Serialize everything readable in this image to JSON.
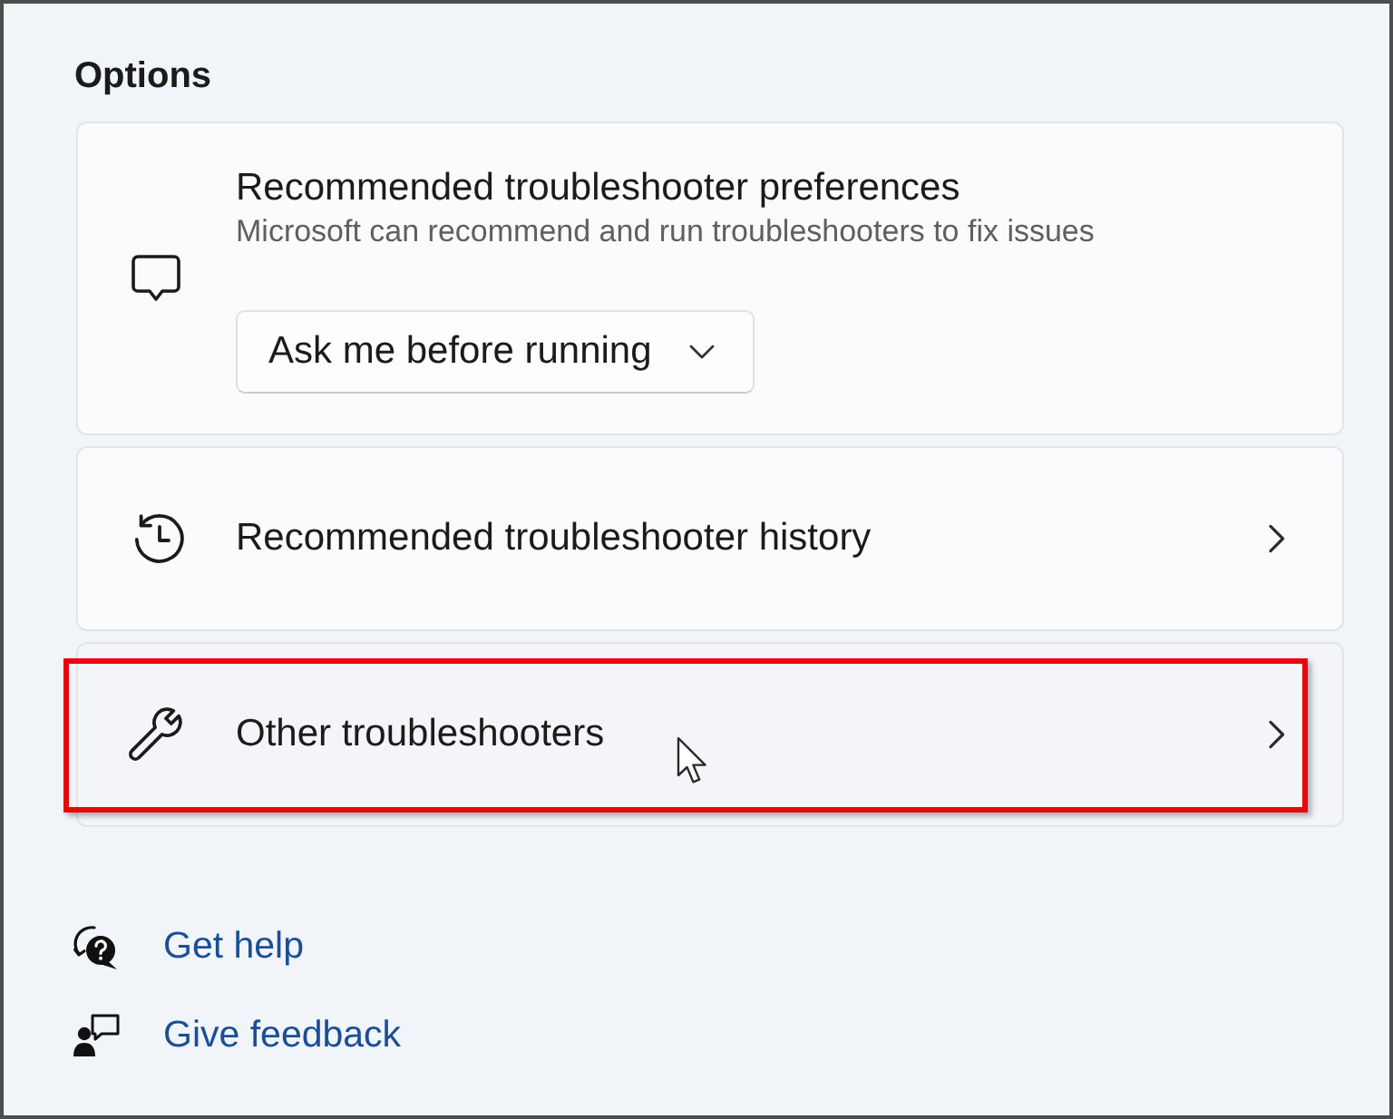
{
  "section_title": "Options",
  "cards": [
    {
      "kind": "setting",
      "title": "Recommended troubleshooter preferences",
      "description": "Microsoft can recommend and run troubleshooters to fix issues",
      "dropdown": {
        "value": "Ask me before running"
      }
    },
    {
      "kind": "link",
      "label": "Recommended troubleshooter history",
      "hovered": false,
      "highlighted": false
    },
    {
      "kind": "link",
      "label": "Other troubleshooters",
      "hovered": true,
      "highlighted": true
    }
  ],
  "links": [
    {
      "label": "Get help"
    },
    {
      "label": "Give feedback"
    }
  ]
}
